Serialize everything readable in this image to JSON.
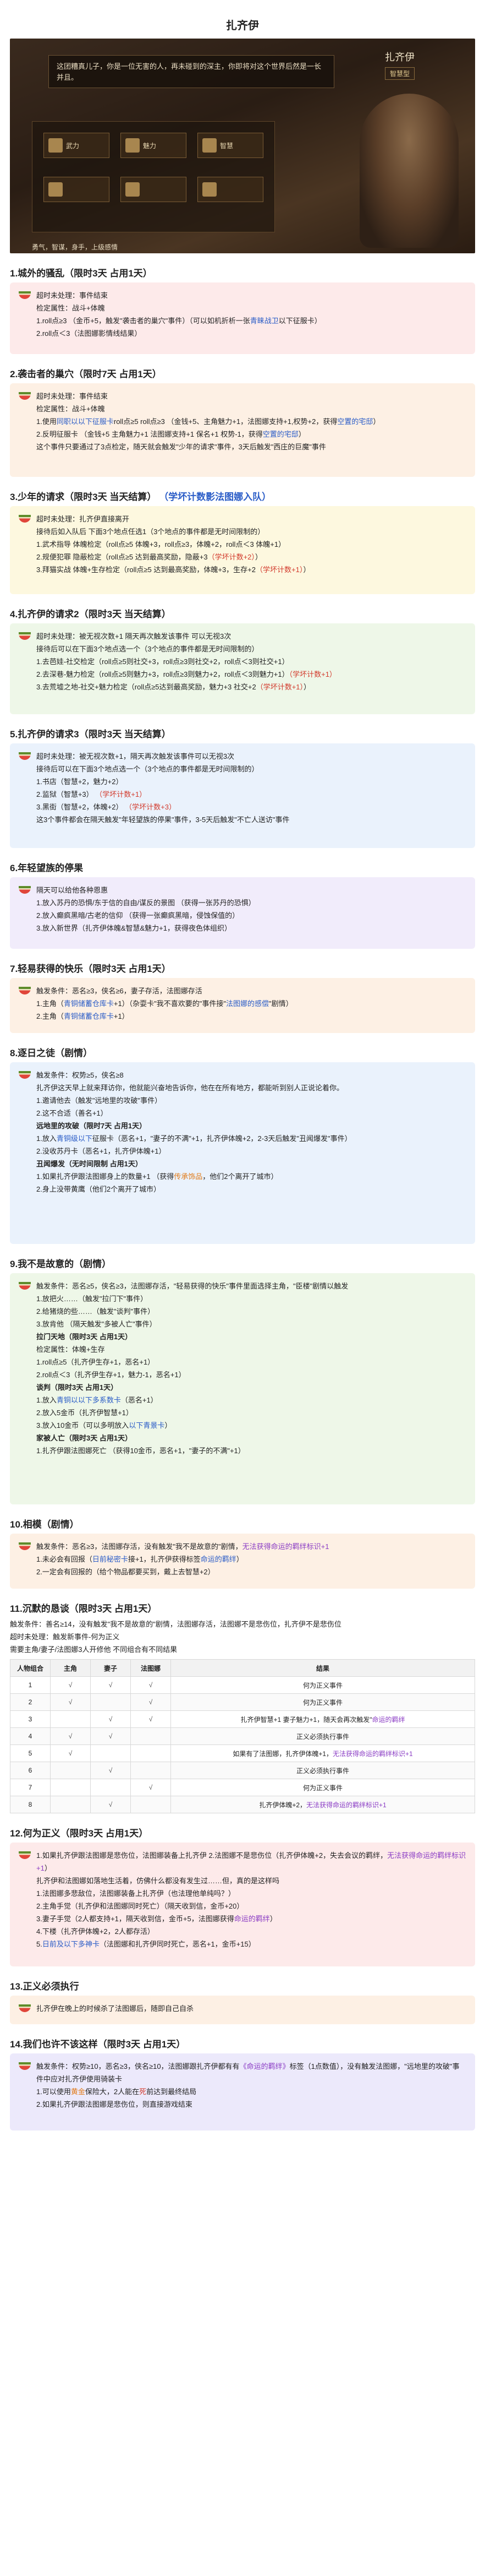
{
  "title": "扎齐伊",
  "hero": {
    "dialog": "这团糟真儿子，你是一位无害的人，再未碰到的深主，你即将对这个世界后然是一长并且。",
    "name": "扎齐伊",
    "role": "智慧型",
    "slots": [
      "武力",
      "魅力",
      "智慧",
      "",
      "",
      ""
    ],
    "tags": "勇气，智谋，身手，上级感情"
  },
  "s1": {
    "title": "1.城外的骚乱（限时3天 占用1天）",
    "l1": "超时未处理：事件结束",
    "l2": "检定属性：战斗+体魄",
    "l3a": "1.roll点≥3 （金币+5，触发\"袭击者的巢穴\"事件）（可以如机折析一张",
    "l3b": "青睐战卫",
    "l3c": "以下征服卡）",
    "l4": "2.roll点＜3（法图娜影情线结果）"
  },
  "s2": {
    "title": "2.袭击者的巢穴（限时7天 占用1天）",
    "l1": "超时未处理：事件结束",
    "l2": "检定属性：战斗+体魄",
    "l3a": "1.使用",
    "l3b": "同职以以下征服卡",
    "l3c": "roll点≥5 roll点≥3 （金钱+5、主角魅力+1，法图娜支持+1,权势+2，获得",
    "l3d": "空置的宅邸",
    "l3e": "）",
    "l4a": "2.反明征服卡 （金钱+5 主角魅力+1 法图娜支持+1 保名+1 权势-1，获得",
    "l4b": "空置的宅邸",
    "l4c": "）",
    "l5": "这个事件只要通过了3点检定，随天就会触发\"少年的请求\"事件，3天后触发\"西庄的巨魔\"事件"
  },
  "s3": {
    "title": "3.少年的请求（限时3天 当天结算）",
    "link": "（学坏计数影法图娜入队）",
    "l1": "超时未处理：扎齐伊直接离开",
    "l2": "接待后如入队后 下面3个地点任选1（3个地点的事件都是无时间限制的）",
    "l3a": "1.武术指导 体魄检定（roll点≥5 体魄+3，roll点≥3，体魄+2，roll点＜3 体魄+1）",
    "l4a": "2.规便犯罪 隐蔽检定（roll点≥5 达到最高奖励，隐蔽+3",
    "l4b": "（学坏计数+2）",
    "l4c": "）",
    "l5a": "3.拜猫实战 体魄+生存检定（roll点≥5 达到最高奖励，体魄+3，生存+2",
    "l5b": "（学坏计数+1）",
    "l5c": "）"
  },
  "s4": {
    "title": "4.扎齐伊的请求2（限时3天 当天结算）",
    "l1": "超时未处理：被无视次数+1 隔天再次触发该事件 可以无视3次",
    "l2": "接待后可以在下面3个地点选一个（3个地点的事件都是无时间限制的）",
    "l3": "1.去芭娃-社交检定（roll点≥5则社交+3，roll点≥3则社交+2，roll点＜3则社交+1）",
    "l4a": "2.去深巷-魅力检定（roll点≥5则魅力+3，roll点≥3则魅力+2，roll点＜3则魅力+1）",
    "l4b": "（学坏计数+1）",
    "l5a": "3.去荒墟之地-社交+魅力检定（roll点≥5达到最高奖励，魅力+3 社交+2",
    "l5b": "（学坏计数+1）",
    "l5c": "）"
  },
  "s5": {
    "title": "5.扎齐伊的请求3（限时3天 当天结算）",
    "l1": "超时未处理：被无视次数+1，隔天再次触发该事件可以无视3次",
    "l2": "接待后可以在下面3个地点选一个（3个地点的事件都是无时间限制的）",
    "l3": "1.书店（智慧+2，魅力+2）",
    "l4a": "2.监狱（智慧+3）",
    "l4b": "（学坏计数+1）",
    "l5a": "3.黑街（智慧+2，体魄+2）",
    "l5b": "（学坏计数+3）",
    "l6": "这3个事件都会在隔天触发\"年轻望族的停果\"事件，3-5天后触发\"不亡人送访\"事件"
  },
  "s6": {
    "title": "6.年轻望族的停果",
    "l1": "隔天可以给他各种恩惠",
    "l2": "1.放入苏丹的恐惧/东于信的自由/谋反的景图 （获得一张苏丹的恐惧）",
    "l3": "2.放入癫疯黑暗/古老的信仰 （获得一张癫疯黑暗，侵蚀保值的）",
    "l4": "3.放入新世界（扎齐伊体魄&智慧&魅力+1，获得夜色体组织）"
  },
  "s7": {
    "title": "7.轻易获得的快乐（限时3天 占用1天）",
    "l1": "触发条件：恶名≥3，侠名≥6，妻子存活，法图娜存活",
    "l2a": "1.主角（",
    "l2b": "青铜储蓄仓库卡",
    "l2c": "+1）（杂耍卡\"我不喜欢要的\"事件接\"",
    "l2d": "法图娜的感偿",
    "l2e": "\"剧情）",
    "l3a": "2.主角（",
    "l3b": "青铜储蓄仓库卡",
    "l3c": "+1）"
  },
  "s8": {
    "title": "8.逐日之徒（剧情）",
    "l1": "触发条件：权势≥5，侠名≥8",
    "l2": "扎齐伊这天早上就来拜访你，他就能兴奋地告诉你，他在在所有地方，都能听到别人正说论着你。",
    "l3": "1.邀请他去（触发\"远地里的攻破\"事件）",
    "l4": "2.这不合适（善名+1）",
    "sub1": "远地里的攻破（限时7天 占用1天）",
    "l5": "1.放入",
    "l5b": "青铜级以下",
    "l5c": "征服卡（恶名+1，\"妻子的不满\"+1，扎齐伊体魄+2，2-3天后触发\"丑闻爆发\"事件）",
    "l6": "2.没收苏丹卡（恶名+1，扎齐伊体魄+1）",
    "sub2": "丑闻爆发（无时间限制 占用1天）",
    "l7a": "1.如果扎齐伊跟法图娜身上的数量+1 （获得",
    "l7b": "传承饰品",
    "l7c": "，他们2个离开了城市）",
    "l8": "2.身上没带黄鹰（他们2个离开了城市）"
  },
  "s9": {
    "title": "9.我不是故意的（剧情）",
    "l1": "触发条件：恶名≥5，侠名≥3，法图娜存活，\"轻易获得的快乐\"事件里面选择主角，\"臣楼\"剧情以触发",
    "l2": "1.放把火……（触发\"拉门下\"事件）",
    "l3": "2.给猪烧的些……（触发\"谈判\"事件）",
    "l4": "3.放肯他 （隔天触发\"多被人亡\"事件）",
    "sub1": "拉门天地（限时3天 占用1天）",
    "l5": "检定属性：体魄+生存",
    "l6": "1.roll点≥5（扎齐伊生存+1，恶名+1）",
    "l7": "2.roll点＜3（扎齐伊生存+1，魅力-1，恶名+1）",
    "sub2": "谈判（限时3天 占用1天）",
    "l8a": "1.放入",
    "l8b": "青铜以以下多系数卡",
    "l8c": "（恶名+1）",
    "l9": "2.放入5金币（扎齐伊智慧+1）",
    "l10a": "3.放入10金币（可以多明放入",
    "l10b": "以下青景卡",
    "l10c": "）",
    "sub3": "家被人亡（限时3天 占用1天）",
    "l11": "1.扎齐伊跟法图娜死亡 （获得10金币，恶名+1，\"妻子的不满\"+1）"
  },
  "s10": {
    "title": "10.相模（剧情）",
    "l1a": "触发条件：恶名≥3，法图娜存活，没有触发\"我不是故意的\"剧情，",
    "l1b": "无法获得命运的羁绊标识+1",
    "l2a": "1.未必会有回报（",
    "l2b": "日前秘密卡",
    "l2c": "接+1，扎齐伊获得标签",
    "l2d": "命运的羁绊",
    "l2e": "）",
    "l3": "2.一定会有回报的（给个物品都要买到，戴上去智慧+2）"
  },
  "s11": {
    "title": "11.沉默的恳谈（限时3天 占用1天）",
    "p1": "触发条件：善名≥14，没有触发\"我不是故意的\"剧情，法图娜存活，法图娜不是悲伤位，扎齐伊不是悲伤位",
    "p2": "超时未处理：触发新事件-何为正义",
    "p3": "需要主角/妻子/法图娜3人开修他 不同组合有不同结果",
    "headers": [
      "人物组合",
      "主角",
      "妻子",
      "法图娜",
      "结果"
    ],
    "rows": [
      {
        "n": "1",
        "a": "√",
        "b": "√",
        "c": "√",
        "r": "何为正义事件",
        "rr": ""
      },
      {
        "n": "2",
        "a": "√",
        "b": "",
        "c": "√",
        "r": "何为正义事件",
        "rr": ""
      },
      {
        "n": "3",
        "a": "",
        "b": "√",
        "c": "√",
        "r": "扎齐伊智慧+1 妻子魅力+1，随天会再次触发\"",
        "rr": "命运的羁绊"
      },
      {
        "n": "4",
        "a": "√",
        "b": "√",
        "c": "",
        "r": "正义必须执行事件",
        "rr": ""
      },
      {
        "n": "5",
        "a": "√",
        "b": "",
        "c": "",
        "r": "如果有了法图娜，扎齐伊体魄+1，",
        "rr": "无法获得命运的羁绊标识+1"
      },
      {
        "n": "6",
        "a": "",
        "b": "√",
        "c": "",
        "r": "正义必须执行事件",
        "rr": ""
      },
      {
        "n": "7",
        "a": "",
        "b": "",
        "c": "√",
        "r": "何为正义事件",
        "rr": ""
      },
      {
        "n": "8",
        "a": "",
        "b": "√",
        "c": "",
        "r": "扎齐伊体魄+2，",
        "rr": "无法获得命运的羁绊标识+1"
      }
    ]
  },
  "s12": {
    "title": "12.何为正义（限时3天 占用1天）",
    "l1a": "1.如果扎齐伊跟法图娜是悲伤位，法图娜装备上扎齐伊 2.法图娜不是悲伤位（扎齐伊体魄+2，失去会议的羁绊，",
    "l1b": "无法获得命运的羁绊标识+1",
    "l1c": "）",
    "l2": "扎齐伊和法图娜如落地生活着，仿佛什么都没有发生过……但，真的是这样吗",
    "l3": "1.法图娜多悲敌位，法图娜装备上扎齐伊（也法理他单纯吗？）",
    "l4": "2.主角手觉（扎齐伊和法图娜同时死亡）（隔天收到信，金币+20）",
    "l5": "3.妻子手觉（2人都支持+1，隔天收到信，金币+5，法图娜获得",
    "l5b": "命运的羁绊",
    "l5c": "）",
    "l6": "4.下楼（扎齐伊体魄+2，2人都存活）",
    "l7a": "5.",
    "l7b": "日前及以下多神卡",
    "l7c": "（法图娜和扎齐伊同时死亡，恶名+1，金币+15）"
  },
  "s13": {
    "title": "13.正义必须执行",
    "l1": "扎齐伊在晚上的时候杀了法图娜后，随即自己自杀"
  },
  "s14": {
    "title": "14.我们也许不该这样（限时3天 占用1天）",
    "l1a": "触发条件：权势≥10，恶名≥3，侠名≥10，法图娜跟扎齐伊都有有",
    "l1b": "《命运的羁绊》",
    "l1c": "标签（1点数值），没有触发法图娜，\"远地里的攻破\"事件中应对扎齐伊使用骑装卡",
    "l2a": "1.可以使用",
    "l2b": "黄金",
    "l2c": "保险大，2人能在",
    "l2d": "死",
    "l2e": "前达到最终结局",
    "l3": "2.如果扎齐伊跟法图娜是悲伤位，则直接游戏结束"
  }
}
